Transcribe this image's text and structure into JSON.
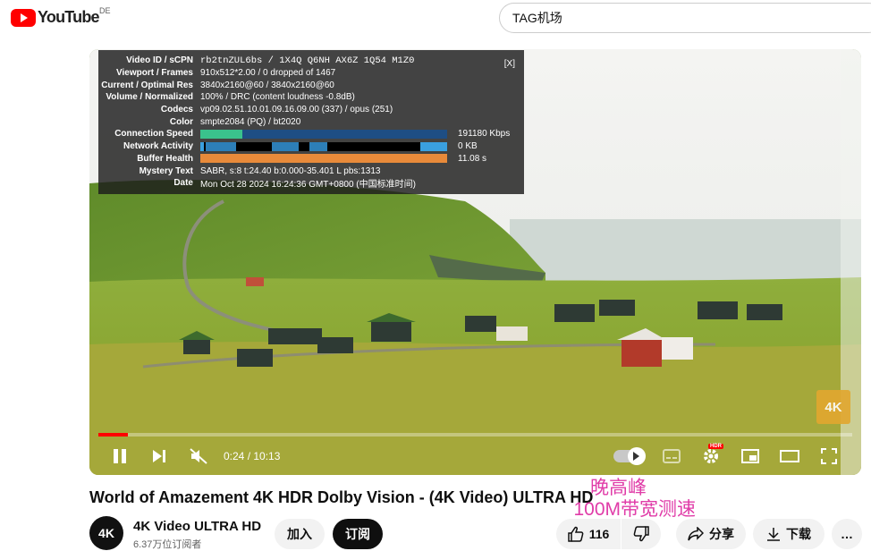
{
  "header": {
    "logo_text": "YouTube",
    "region": "DE",
    "search_value": "TAG机场"
  },
  "stats": {
    "close": "[X]",
    "rows": [
      {
        "label": "Video ID / sCPN",
        "value": "rb2tnZUL6bs / 1X4Q Q6NH AX6Z 1Q54 M1Z0"
      },
      {
        "label": "Viewport / Frames",
        "value": "910x512*2.00 / 0 dropped of 1467"
      },
      {
        "label": "Current / Optimal Res",
        "value": "3840x2160@60 / 3840x2160@60"
      },
      {
        "label": "Volume / Normalized",
        "value": "100% / DRC (content loudness -0.8dB)"
      },
      {
        "label": "Codecs",
        "value": "vp09.02.51.10.01.09.16.09.00 (337) / opus (251)"
      },
      {
        "label": "Color",
        "value": "smpte2084 (PQ) / bt2020"
      },
      {
        "label": "Connection Speed",
        "value": "191180 Kbps"
      },
      {
        "label": "Network Activity",
        "value": "0 KB"
      },
      {
        "label": "Buffer Health",
        "value": "11.08 s"
      },
      {
        "label": "Mystery Text",
        "value": "SABR, s:8 t:24.40 b:0.000-35.401 L pbs:1313"
      },
      {
        "label": "Date",
        "value": "Mon Oct 28 2024 16:24:36 GMT+0800 (中国标准时间)"
      }
    ],
    "connection_fill": 0.17
  },
  "player": {
    "badge": "4K",
    "time": "0:24 / 10:13",
    "progress": 0.039,
    "hdr_badge": "HDR"
  },
  "video": {
    "title": "World of Amazement 4K HDR Dolby Vision - (4K Video) ULTRA HD",
    "overlay_line1": "晚高峰",
    "overlay_line2": "100M带宽测速"
  },
  "channel": {
    "avatar_text": "4K",
    "name": "4K Video ULTRA HD",
    "subs": "6.37万位订阅者",
    "join_label": "加入",
    "subscribe_label": "订阅",
    "likes": "116",
    "share_label": "分享",
    "download_label": "下载",
    "more_label": "…"
  }
}
